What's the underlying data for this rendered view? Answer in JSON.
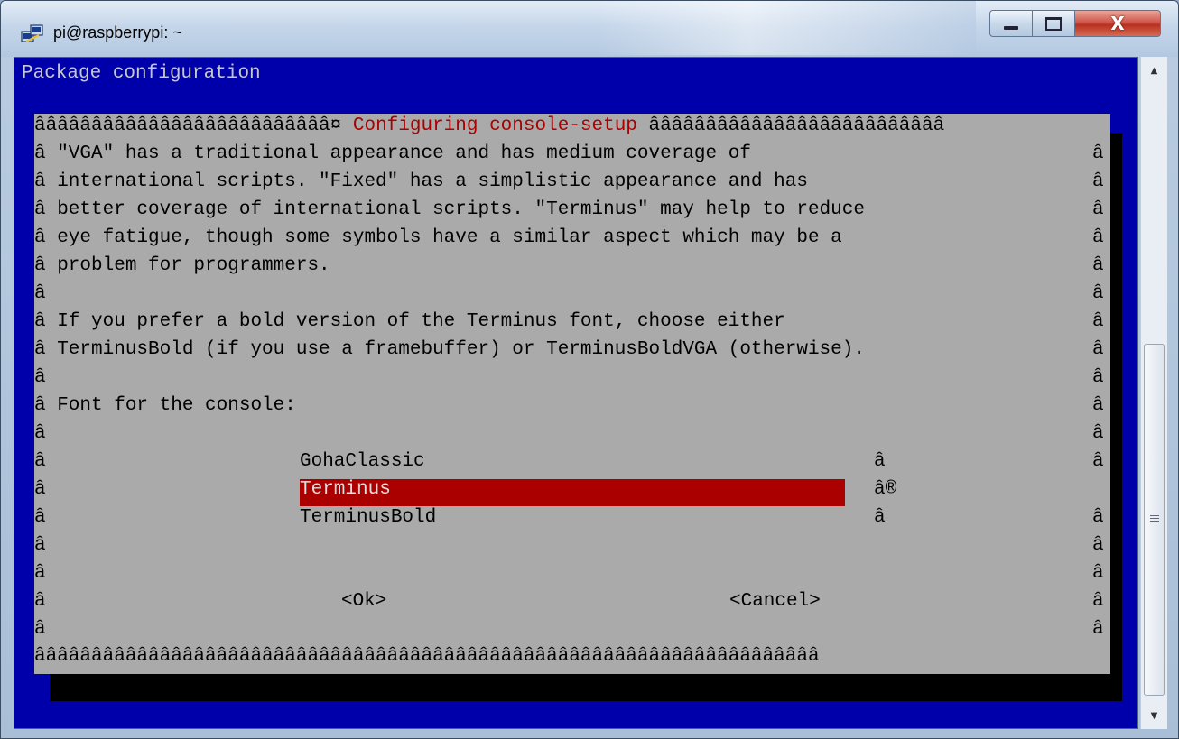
{
  "window": {
    "title": "pi@raspberrypi: ~",
    "icon": "putty-icon",
    "controls": {
      "minimize": "minimize-icon",
      "maximize": "maximize-icon",
      "close": "X"
    }
  },
  "terminal": {
    "header": "Package configuration",
    "dialog": {
      "frame_left": "ââââââââââââââââââââââââââ¤ ",
      "title": "Configuring console-setup",
      "frame_right": " ââââââââââââââââââââââââââ",
      "border_char": "â",
      "lines": [
        "â \"VGA\" has a traditional appearance and has medium coverage of",
        "â international scripts. \"Fixed\" has a simplistic appearance and has",
        "â better coverage of international scripts. \"Terminus\" may help to reduce",
        "â eye fatigue, though some symbols have a similar aspect which may be a",
        "â problem for programmers.",
        "â",
        "â If you prefer a bold version of the Terminus font, choose either",
        "â TerminusBold (if you use a framebuffer) or TerminusBoldVGA (otherwise).",
        "â",
        "â Font for the console:",
        "â"
      ],
      "menu": {
        "items": [
          "GohaClassic",
          "Terminus",
          "TerminusBold"
        ],
        "selected": "Terminus",
        "marks": [
          "â",
          "â®",
          "â"
        ],
        "line_prefix": "â"
      },
      "blank_line": "â",
      "ok_label": "<Ok>",
      "cancel_label": "<Cancel>",
      "bottom": "âââââââââââââââââââââââââââââââââââââââââââââââââââââââââââââââââââââ"
    }
  },
  "colors": {
    "terminal_bg": "#0000aa",
    "dialog_bg": "#aaaaaa",
    "title_red": "#aa0000",
    "selection_bg": "#aa0000"
  },
  "scrollbar": {
    "up": "▲",
    "down": "▼"
  }
}
